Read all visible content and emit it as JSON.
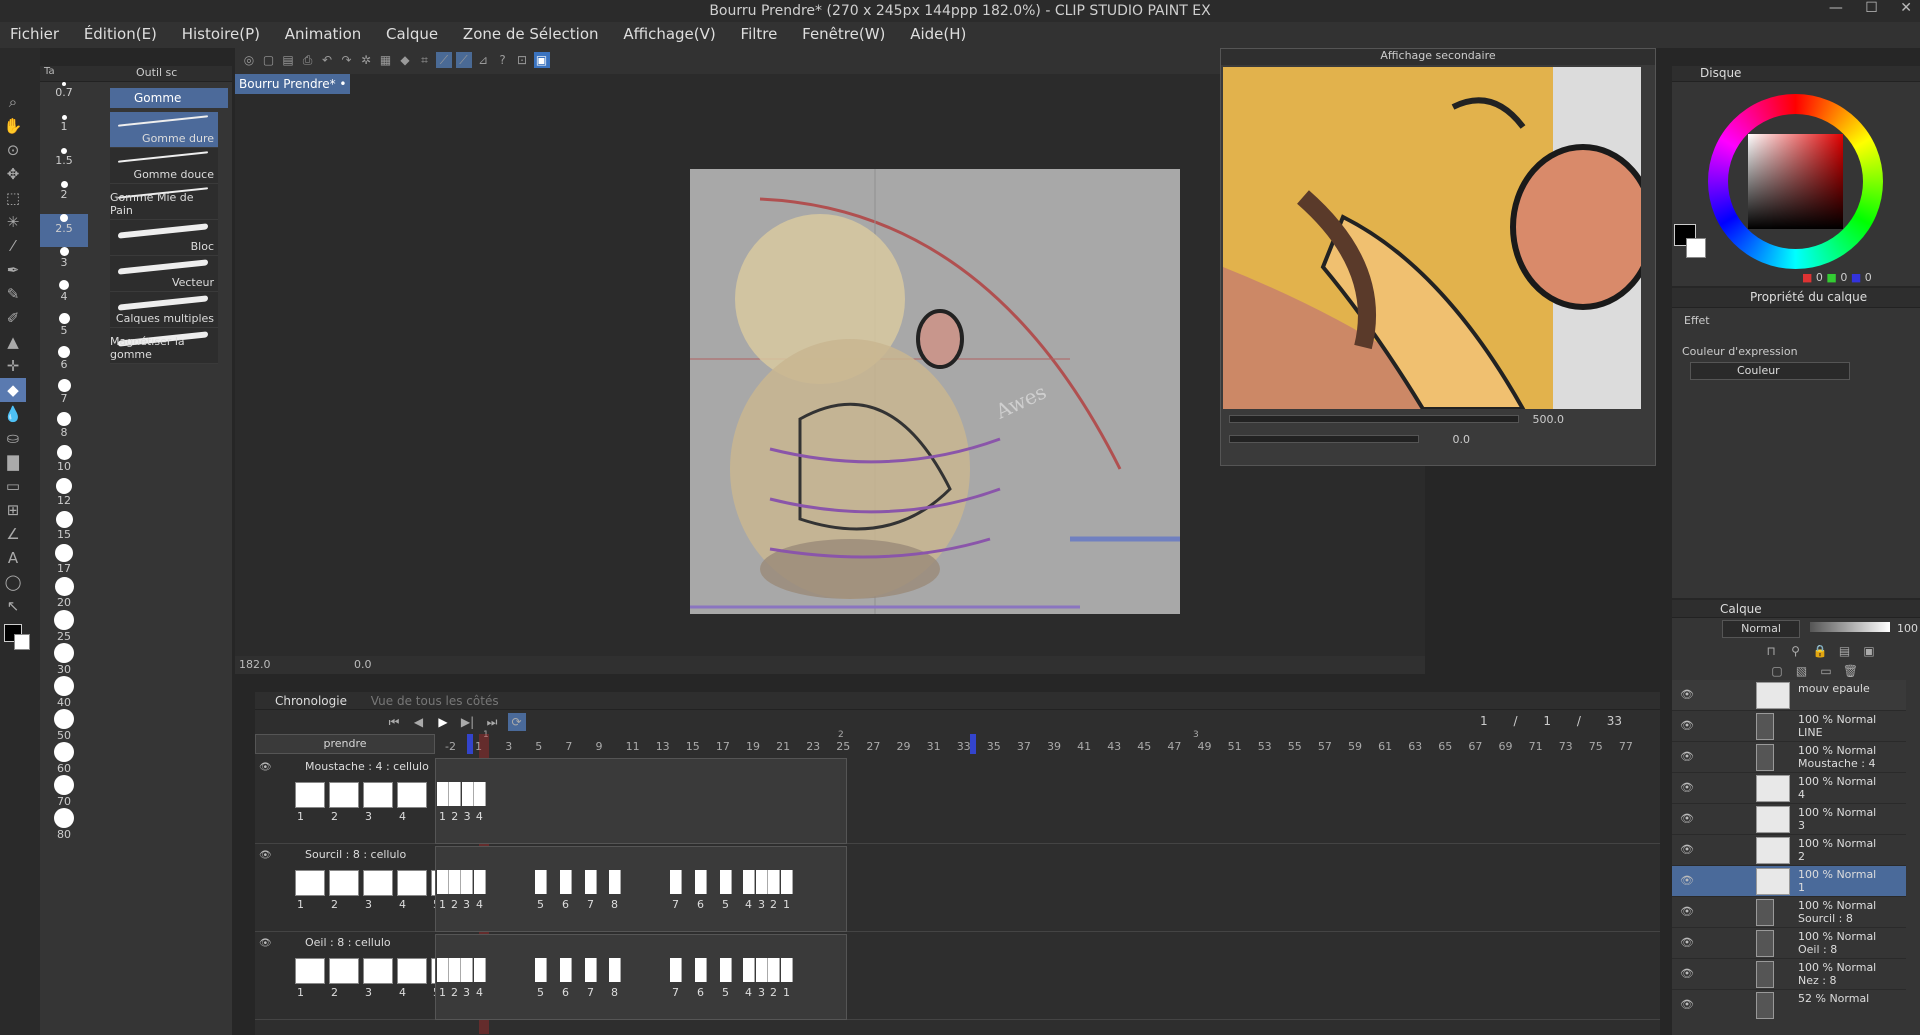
{
  "window": {
    "title": "Bourru Prendre* (270 x 245px 144ppp 182.0%) - CLIP STUDIO PAINT EX",
    "controls": "— ☐ ✕"
  },
  "menu": [
    "Fichier",
    "Édition(E)",
    "Histoire(P)",
    "Animation",
    "Calque",
    "Zone de Sélection",
    "Affichage(V)",
    "Filtre",
    "Fenêtre(W)",
    "Aide(H)"
  ],
  "tool_panel": {
    "tab_size": "Ta",
    "tab_tool": "Outil sc",
    "group": "Gomme",
    "brushes": [
      "Gomme dure",
      "Gomme douce",
      "Gomme Mie de Pain",
      "Bloc",
      "Vecteur",
      "Calques multiples",
      "Magnétiser la gomme"
    ]
  },
  "sizes": [
    "0.7",
    "1",
    "1.5",
    "2",
    "2.5",
    "3",
    "4",
    "5",
    "6",
    "7",
    "8",
    "10",
    "12",
    "15",
    "17",
    "20",
    "25",
    "30",
    "40",
    "50",
    "60",
    "70",
    "80"
  ],
  "canvas": {
    "tab": "Bourru Prendre*",
    "zoom": "182.0",
    "rotation": "0.0",
    "signature": "Awes"
  },
  "sub_view": {
    "title": "Affichage secondaire",
    "zoom": "500.0",
    "rotation": "0.0"
  },
  "color": {
    "tab": "Disque",
    "r": "0",
    "g": "0",
    "b": "0"
  },
  "layer_props": {
    "tab": "Propriété du calque",
    "effect": "Effet",
    "expression": "Couleur d'expression",
    "mode": "Couleur"
  },
  "layers_panel": {
    "tab": "Calque",
    "blend": "Normal",
    "opacity": "100",
    "layers": [
      {
        "a": "mouv epaule",
        "b": ""
      },
      {
        "a": "100 % Normal",
        "b": "LINE"
      },
      {
        "a": "100 % Normal",
        "b": "Moustache : 4"
      },
      {
        "a": "100 % Normal",
        "b": "4"
      },
      {
        "a": "100 % Normal",
        "b": "3"
      },
      {
        "a": "100 % Normal",
        "b": "2"
      },
      {
        "a": "100 % Normal",
        "b": "1"
      },
      {
        "a": "100 % Normal",
        "b": "Sourcil : 8"
      },
      {
        "a": "100 % Normal",
        "b": "Oeil : 8"
      },
      {
        "a": "100 % Normal",
        "b": "Nez : 8"
      },
      {
        "a": "52 % Normal",
        "b": ""
      }
    ]
  },
  "timeline": {
    "tab": "Chronologie",
    "tab2": "Vue de tous les côtés",
    "name": "prendre",
    "counter": [
      "1",
      "/",
      "1",
      "/",
      "33"
    ],
    "tracks": [
      {
        "name": "Moustache : 4 : cellulo",
        "cels": [
          "1",
          "2",
          "3",
          "4"
        ],
        "marks": [
          "1",
          "2",
          "3",
          "4"
        ]
      },
      {
        "name": "Sourcil : 8 : cellulo",
        "cels": [
          "1",
          "2",
          "3",
          "4",
          "5"
        ],
        "marks": [
          "1",
          "2",
          "3",
          "4",
          "5",
          "6",
          "7",
          "8",
          "7",
          "6",
          "5",
          "4",
          "3",
          "2",
          "1"
        ]
      },
      {
        "name": "Oeil : 8 : cellulo",
        "cels": [
          "1",
          "2",
          "3",
          "4",
          "5"
        ],
        "marks": [
          "1",
          "2",
          "3",
          "4",
          "5",
          "6",
          "7",
          "8",
          "7",
          "6",
          "5",
          "4",
          "3",
          "2",
          "1"
        ]
      }
    ],
    "ruler": [
      "-2",
      "1",
      "3",
      "5",
      "7",
      "9",
      "11",
      "13",
      "15",
      "17",
      "19",
      "21",
      "23",
      "25",
      "27",
      "29",
      "31",
      "33",
      "35",
      "37",
      "39",
      "41",
      "43",
      "45",
      "47",
      "49",
      "51",
      "53",
      "55",
      "57",
      "59",
      "61",
      "63",
      "65",
      "67",
      "69",
      "71",
      "73",
      "75",
      "77"
    ],
    "second_marks": [
      "1",
      "2",
      "3"
    ]
  }
}
